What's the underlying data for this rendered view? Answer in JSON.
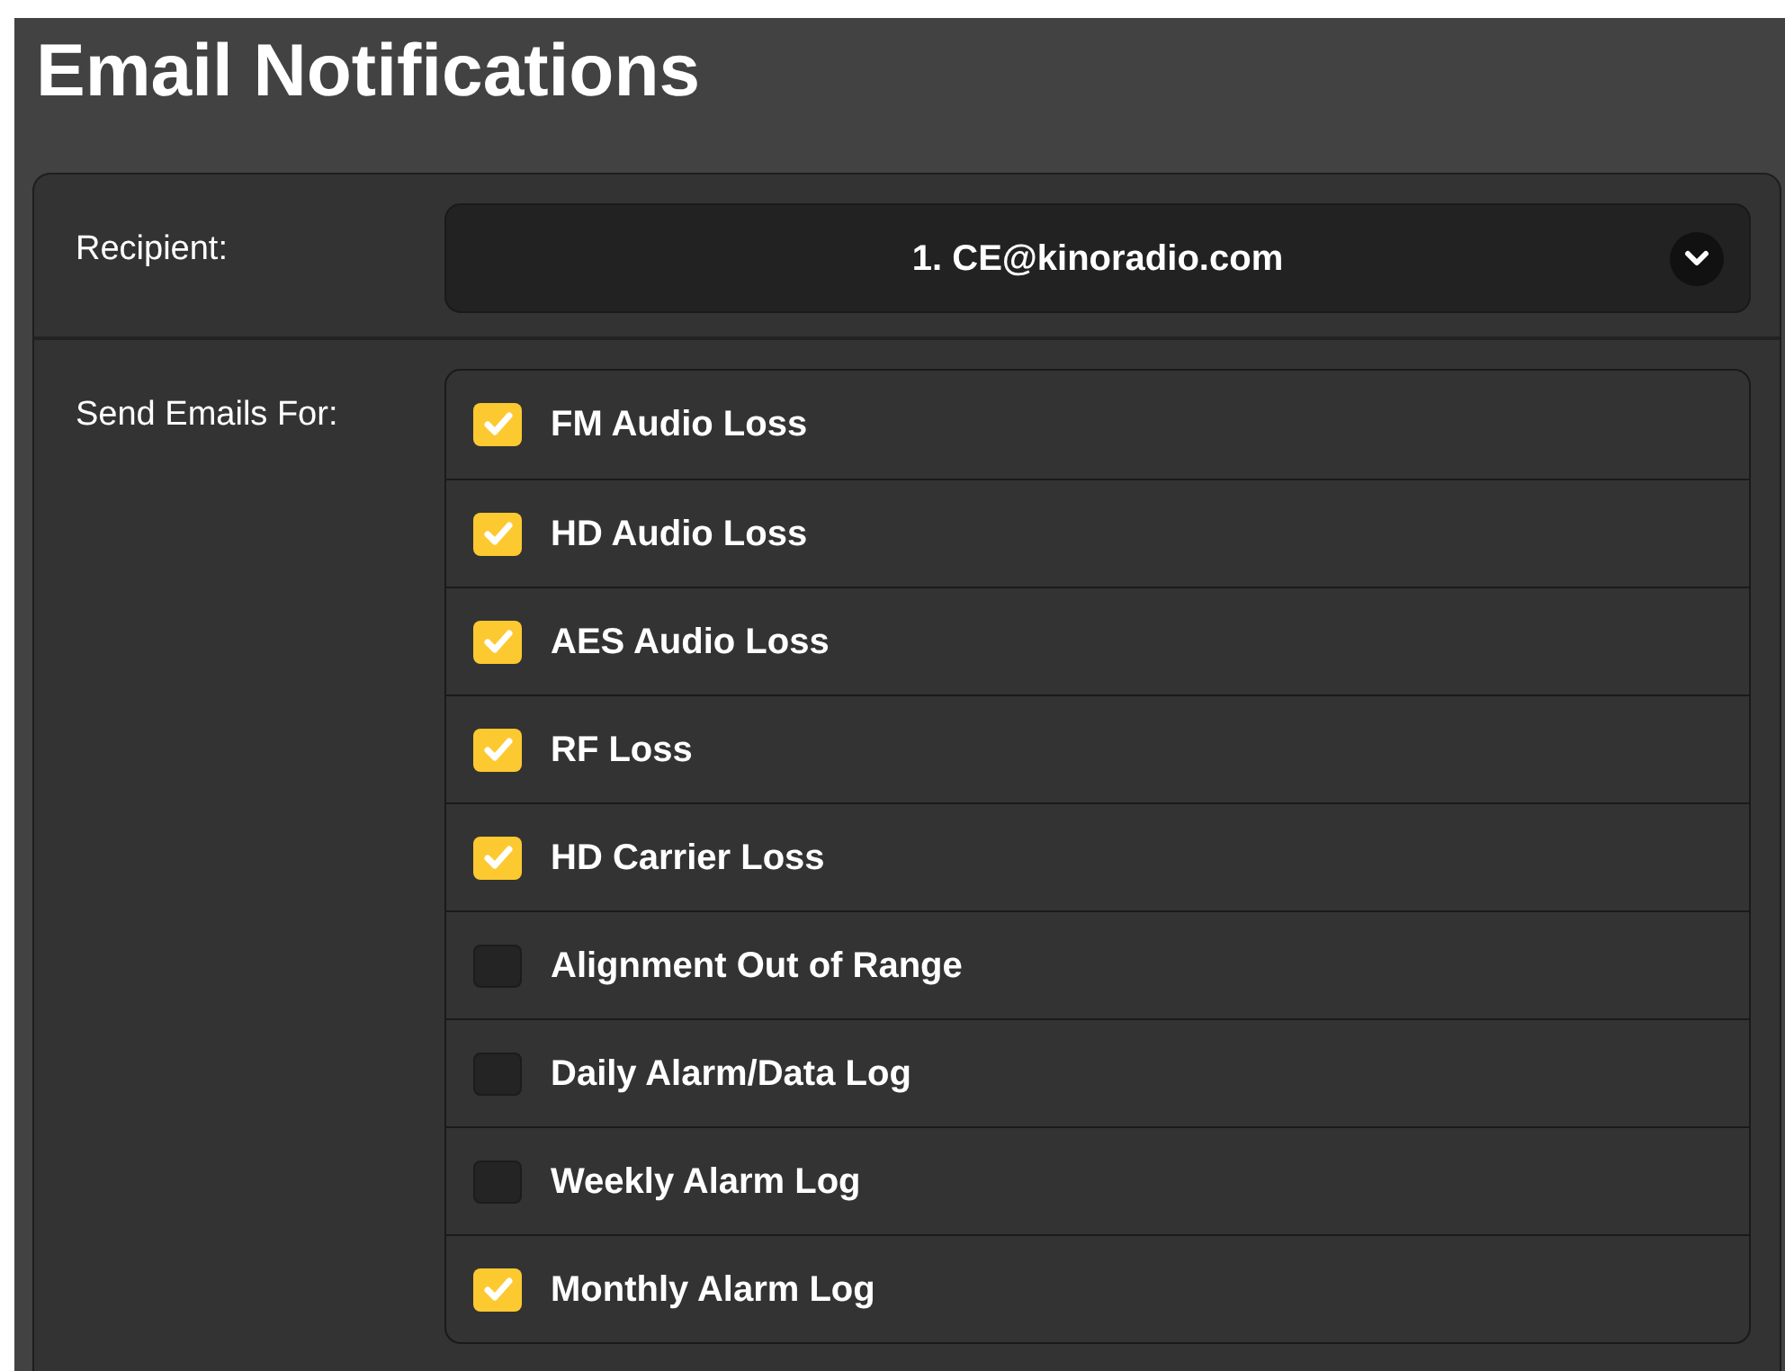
{
  "title": "Email Notifications",
  "recipient": {
    "label": "Recipient:",
    "value": "1. CE@kinoradio.com"
  },
  "send_emails_for": {
    "label": "Send Emails For:",
    "items": [
      {
        "label": "FM Audio Loss",
        "checked": true
      },
      {
        "label": "HD Audio Loss",
        "checked": true
      },
      {
        "label": "AES Audio Loss",
        "checked": true
      },
      {
        "label": "RF Loss",
        "checked": true
      },
      {
        "label": "HD Carrier Loss",
        "checked": true
      },
      {
        "label": "Alignment Out of Range",
        "checked": false
      },
      {
        "label": "Daily Alarm/Data Log",
        "checked": false
      },
      {
        "label": "Weekly Alarm Log",
        "checked": false
      },
      {
        "label": "Monthly Alarm Log",
        "checked": true
      }
    ]
  }
}
